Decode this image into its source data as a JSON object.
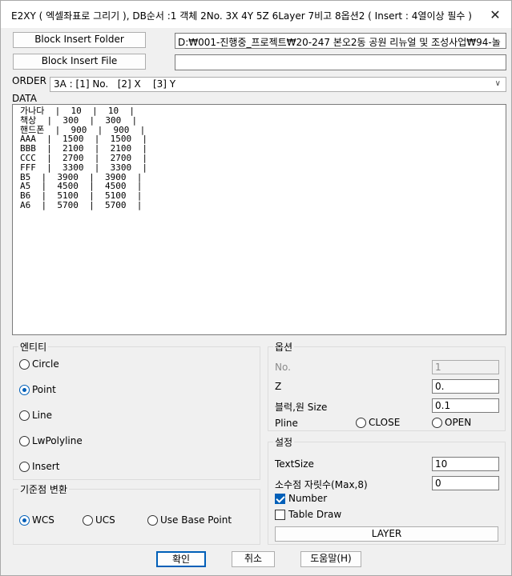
{
  "window": {
    "title": "E2XY ( 엑셀좌표로 그리기 ), DB순서 :1 객체 2No. 3X 4Y 5Z 6Layer 7비고 8옵션2 ( Insert : 4열이상 필수 )",
    "close_glyph": "✕"
  },
  "block_insert_folder": {
    "button_label": "Block Insert Folder",
    "value": "D:₩001-진행중_프로젝트₩20-247 본오2동 공원 리뉴얼 및 조성사업₩94-놀"
  },
  "block_insert_file": {
    "button_label": "Block Insert File",
    "value": ""
  },
  "order": {
    "label": "ORDER",
    "selected": "3A : [1] No.   [2] X    [3] Y"
  },
  "data": {
    "label": "DATA",
    "text": "가나다  |  10  |  10  |\n책상  |  300  |  300  |\n핸드폰  |  900  |  900  |\nAAA  |  1500  |  1500  |\nBBB  |  2100  |  2100  |\nCCC  |  2700  |  2700  |\nFFF  |  3300  |  3300  |\nB5  |  3900  |  3900  |\nA5  |  4500  |  4500  |\nB6  |  5100  |  5100  |\nA6  |  5700  |  5700  |"
  },
  "entity": {
    "title": "엔티티",
    "options": [
      "Circle",
      "Point",
      "Line",
      "LwPolyline",
      "Insert"
    ],
    "selected": "Point"
  },
  "basepoint": {
    "title": "기준점 변환",
    "options": [
      "WCS",
      "UCS",
      "Use Base Point"
    ],
    "selected": "WCS"
  },
  "options": {
    "title": "옵션",
    "no_label": "No.",
    "no_value": "1",
    "z_label": "Z",
    "z_value": "0.",
    "block_size_label": "블럭,원 Size",
    "block_size_value": "0.1",
    "pline_label": "Pline",
    "pline_close": "CLOSE",
    "pline_open": "OPEN"
  },
  "settings": {
    "title": "설정",
    "textsize_label": "TextSize",
    "textsize_value": "10",
    "decimal_label": "소수점 자릿수(Max,8)",
    "decimal_value": "0",
    "number_label": "Number",
    "number_checked": true,
    "table_draw_label": "Table Draw",
    "table_draw_checked": false,
    "layer_button": "LAYER"
  },
  "footer": {
    "ok": "확인",
    "cancel": "취소",
    "help": "도움말(H)"
  },
  "colors": {
    "accent": "#005fb8",
    "background": "#f0f0f0"
  }
}
